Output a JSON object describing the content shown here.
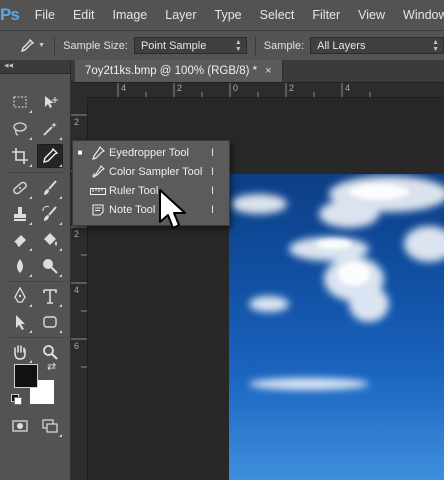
{
  "app": {
    "logo": "Ps"
  },
  "menubar": {
    "items": [
      "File",
      "Edit",
      "Image",
      "Layer",
      "Type",
      "Select",
      "Filter",
      "View",
      "Window"
    ]
  },
  "options": {
    "sample_size_label": "Sample Size:",
    "sample_size_value": "Point Sample",
    "sample_label": "Sample:",
    "sample_value": "All Layers",
    "tool_icon": "eyedropper-icon"
  },
  "document": {
    "tab_title": "7oy2t1ks.bmp @ 100% (RGB/8) *",
    "close_glyph": "×",
    "ruler_top": [
      "4",
      "2",
      "0",
      "2",
      "4"
    ],
    "ruler_left": [
      "2",
      "0",
      "2",
      "4",
      "6"
    ]
  },
  "flyout": {
    "items": [
      {
        "label": "Eyedropper Tool",
        "shortcut": "I",
        "icon": "eyedropper-icon",
        "selected": true
      },
      {
        "label": "Color Sampler Tool",
        "shortcut": "I",
        "icon": "color-sampler-icon",
        "selected": false
      },
      {
        "label": "Ruler Tool",
        "shortcut": "I",
        "icon": "ruler-icon",
        "selected": false
      },
      {
        "label": "Note Tool",
        "shortcut": "I",
        "icon": "note-icon",
        "selected": false
      }
    ],
    "bullet": "■"
  },
  "colors": {
    "foreground": "#111111",
    "background": "#ffffff",
    "ui_dark": "#535353",
    "sky_top": "#0d3e86",
    "sky_bottom": "#3f8fde"
  },
  "panel": {
    "collapse_glyph": "◂◂"
  }
}
